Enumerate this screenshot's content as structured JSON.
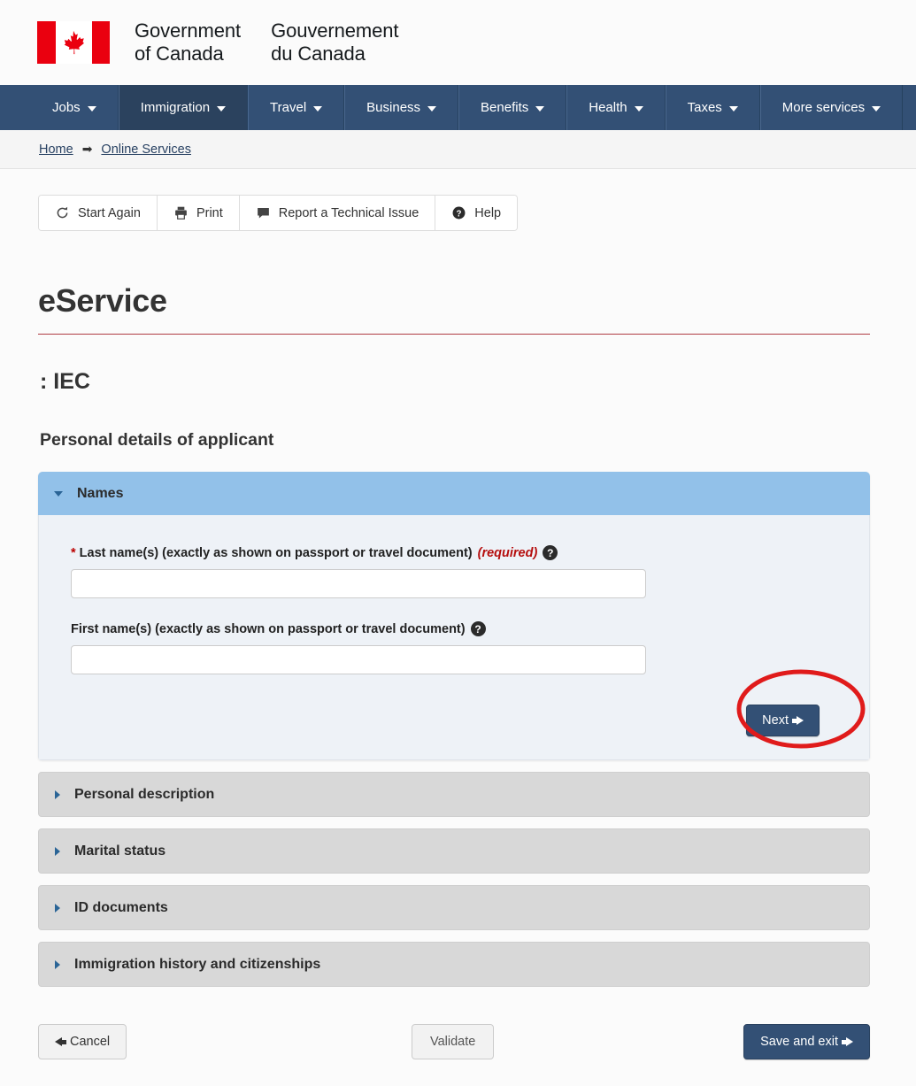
{
  "brand": {
    "flag_icon": "canada-flag-icon",
    "wordmark_en": "Government\nof Canada",
    "wordmark_en_line1": "Government",
    "wordmark_en_line2": "of Canada",
    "wordmark_fr_line1": "Gouvernement",
    "wordmark_fr_line2": "du Canada"
  },
  "nav": {
    "items": [
      {
        "label": "Jobs",
        "active": false
      },
      {
        "label": "Immigration",
        "active": true
      },
      {
        "label": "Travel",
        "active": false
      },
      {
        "label": "Business",
        "active": false
      },
      {
        "label": "Benefits",
        "active": false
      },
      {
        "label": "Health",
        "active": false
      },
      {
        "label": "Taxes",
        "active": false
      },
      {
        "label": "More services",
        "active": false
      }
    ]
  },
  "breadcrumb": {
    "separator": "➡",
    "items": [
      {
        "label": "Home"
      },
      {
        "label": "Online Services"
      }
    ]
  },
  "toolbar": {
    "buttons": [
      {
        "label": "Start Again",
        "icon": "refresh-icon"
      },
      {
        "label": "Print",
        "icon": "printer-icon"
      },
      {
        "label": "Report a Technical Issue",
        "icon": "speech-bubble-icon"
      },
      {
        "label": "Help",
        "icon": "question-circle-icon"
      }
    ]
  },
  "page": {
    "title": "eService",
    "subtitle": ": IEC",
    "section_heading": "Personal details of applicant"
  },
  "form": {
    "open_section": {
      "label": "Names",
      "expanded": true,
      "fields": [
        {
          "label": "Last name(s) (exactly as shown on passport or travel document)",
          "required": true,
          "required_marker": "*",
          "required_tag": "(required)",
          "value": "",
          "placeholder": "",
          "help_icon": "question-circle-icon"
        },
        {
          "label": "First name(s) (exactly as shown on passport or travel document)",
          "required": false,
          "required_marker": "",
          "required_tag": "",
          "value": "",
          "placeholder": "",
          "help_icon": "question-circle-icon"
        }
      ],
      "next_label": "Next"
    },
    "closed_sections": [
      {
        "label": "Personal description",
        "expanded": false
      },
      {
        "label": "Marital status",
        "expanded": false
      },
      {
        "label": "ID documents",
        "expanded": false
      },
      {
        "label": "Immigration history and citizenships",
        "expanded": false
      }
    ]
  },
  "footer": {
    "cancel_label": "Cancel",
    "validate_label": "Validate",
    "save_label": "Save and exit"
  },
  "annotation": {
    "shape": "ellipse",
    "color": "#e01b1b",
    "target": "Next"
  },
  "colors": {
    "nav_background": "#335075",
    "nav_active": "#2b425e",
    "accent_red": "#af3c43",
    "panel_header_blue": "#92c1e9",
    "panel_body": "#eef2f7",
    "closed_panel": "#d8d8d8",
    "primary_button": "#335075",
    "annotation_red": "#e01b1b",
    "flag_red": "#ea000f"
  }
}
